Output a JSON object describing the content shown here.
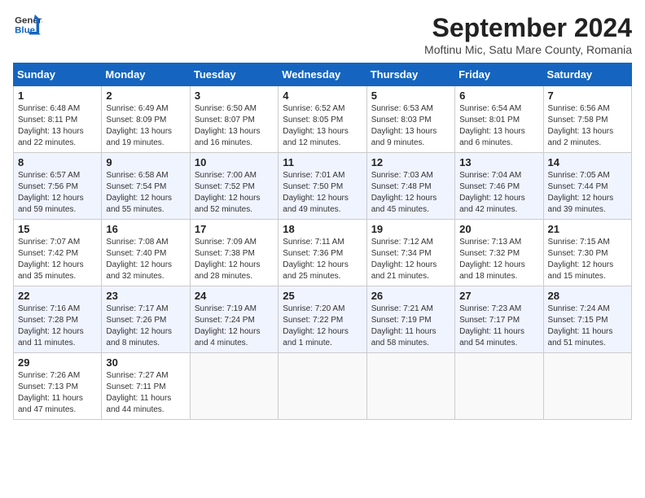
{
  "header": {
    "logo_line1": "General",
    "logo_line2": "Blue",
    "month": "September 2024",
    "location": "Moftinu Mic, Satu Mare County, Romania"
  },
  "weekdays": [
    "Sunday",
    "Monday",
    "Tuesday",
    "Wednesday",
    "Thursday",
    "Friday",
    "Saturday"
  ],
  "weeks": [
    [
      {
        "day": "1",
        "info": "Sunrise: 6:48 AM\nSunset: 8:11 PM\nDaylight: 13 hours\nand 22 minutes."
      },
      {
        "day": "2",
        "info": "Sunrise: 6:49 AM\nSunset: 8:09 PM\nDaylight: 13 hours\nand 19 minutes."
      },
      {
        "day": "3",
        "info": "Sunrise: 6:50 AM\nSunset: 8:07 PM\nDaylight: 13 hours\nand 16 minutes."
      },
      {
        "day": "4",
        "info": "Sunrise: 6:52 AM\nSunset: 8:05 PM\nDaylight: 13 hours\nand 12 minutes."
      },
      {
        "day": "5",
        "info": "Sunrise: 6:53 AM\nSunset: 8:03 PM\nDaylight: 13 hours\nand 9 minutes."
      },
      {
        "day": "6",
        "info": "Sunrise: 6:54 AM\nSunset: 8:01 PM\nDaylight: 13 hours\nand 6 minutes."
      },
      {
        "day": "7",
        "info": "Sunrise: 6:56 AM\nSunset: 7:58 PM\nDaylight: 13 hours\nand 2 minutes."
      }
    ],
    [
      {
        "day": "8",
        "info": "Sunrise: 6:57 AM\nSunset: 7:56 PM\nDaylight: 12 hours\nand 59 minutes."
      },
      {
        "day": "9",
        "info": "Sunrise: 6:58 AM\nSunset: 7:54 PM\nDaylight: 12 hours\nand 55 minutes."
      },
      {
        "day": "10",
        "info": "Sunrise: 7:00 AM\nSunset: 7:52 PM\nDaylight: 12 hours\nand 52 minutes."
      },
      {
        "day": "11",
        "info": "Sunrise: 7:01 AM\nSunset: 7:50 PM\nDaylight: 12 hours\nand 49 minutes."
      },
      {
        "day": "12",
        "info": "Sunrise: 7:03 AM\nSunset: 7:48 PM\nDaylight: 12 hours\nand 45 minutes."
      },
      {
        "day": "13",
        "info": "Sunrise: 7:04 AM\nSunset: 7:46 PM\nDaylight: 12 hours\nand 42 minutes."
      },
      {
        "day": "14",
        "info": "Sunrise: 7:05 AM\nSunset: 7:44 PM\nDaylight: 12 hours\nand 39 minutes."
      }
    ],
    [
      {
        "day": "15",
        "info": "Sunrise: 7:07 AM\nSunset: 7:42 PM\nDaylight: 12 hours\nand 35 minutes."
      },
      {
        "day": "16",
        "info": "Sunrise: 7:08 AM\nSunset: 7:40 PM\nDaylight: 12 hours\nand 32 minutes."
      },
      {
        "day": "17",
        "info": "Sunrise: 7:09 AM\nSunset: 7:38 PM\nDaylight: 12 hours\nand 28 minutes."
      },
      {
        "day": "18",
        "info": "Sunrise: 7:11 AM\nSunset: 7:36 PM\nDaylight: 12 hours\nand 25 minutes."
      },
      {
        "day": "19",
        "info": "Sunrise: 7:12 AM\nSunset: 7:34 PM\nDaylight: 12 hours\nand 21 minutes."
      },
      {
        "day": "20",
        "info": "Sunrise: 7:13 AM\nSunset: 7:32 PM\nDaylight: 12 hours\nand 18 minutes."
      },
      {
        "day": "21",
        "info": "Sunrise: 7:15 AM\nSunset: 7:30 PM\nDaylight: 12 hours\nand 15 minutes."
      }
    ],
    [
      {
        "day": "22",
        "info": "Sunrise: 7:16 AM\nSunset: 7:28 PM\nDaylight: 12 hours\nand 11 minutes."
      },
      {
        "day": "23",
        "info": "Sunrise: 7:17 AM\nSunset: 7:26 PM\nDaylight: 12 hours\nand 8 minutes."
      },
      {
        "day": "24",
        "info": "Sunrise: 7:19 AM\nSunset: 7:24 PM\nDaylight: 12 hours\nand 4 minutes."
      },
      {
        "day": "25",
        "info": "Sunrise: 7:20 AM\nSunset: 7:22 PM\nDaylight: 12 hours\nand 1 minute."
      },
      {
        "day": "26",
        "info": "Sunrise: 7:21 AM\nSunset: 7:19 PM\nDaylight: 11 hours\nand 58 minutes."
      },
      {
        "day": "27",
        "info": "Sunrise: 7:23 AM\nSunset: 7:17 PM\nDaylight: 11 hours\nand 54 minutes."
      },
      {
        "day": "28",
        "info": "Sunrise: 7:24 AM\nSunset: 7:15 PM\nDaylight: 11 hours\nand 51 minutes."
      }
    ],
    [
      {
        "day": "29",
        "info": "Sunrise: 7:26 AM\nSunset: 7:13 PM\nDaylight: 11 hours\nand 47 minutes."
      },
      {
        "day": "30",
        "info": "Sunrise: 7:27 AM\nSunset: 7:11 PM\nDaylight: 11 hours\nand 44 minutes."
      },
      {
        "day": "",
        "info": ""
      },
      {
        "day": "",
        "info": ""
      },
      {
        "day": "",
        "info": ""
      },
      {
        "day": "",
        "info": ""
      },
      {
        "day": "",
        "info": ""
      }
    ]
  ]
}
